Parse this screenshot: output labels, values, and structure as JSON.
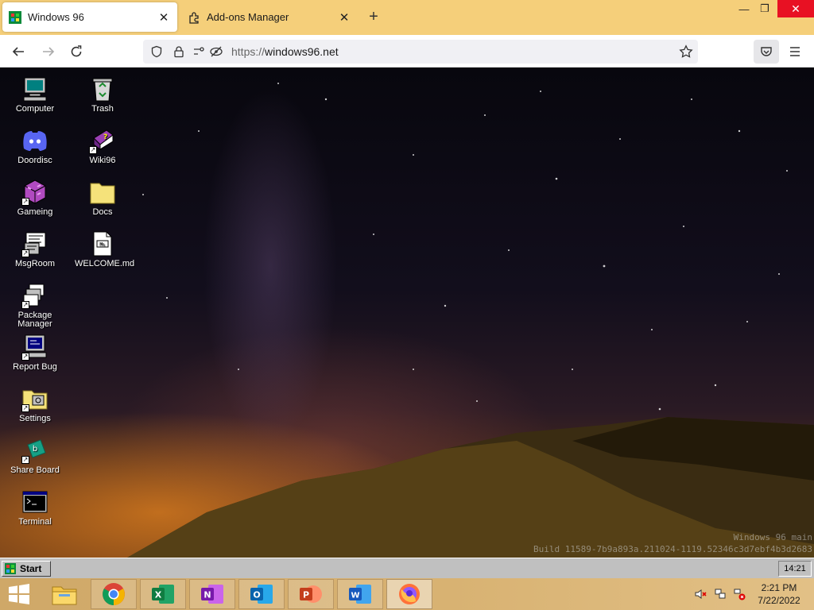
{
  "browser": {
    "tabs": [
      {
        "title": "Windows 96",
        "favicon": "windows96-favicon",
        "active": true
      },
      {
        "title": "Add-ons Manager",
        "favicon": "puzzle-piece-icon",
        "active": false
      }
    ],
    "new_tab_icon": "+",
    "url_scheme": "https://",
    "url_host": "windows96.net",
    "window_controls": {
      "minimize": "—",
      "restore": "❐",
      "close": "✕"
    }
  },
  "desktop": {
    "icons": [
      {
        "label": "Computer",
        "icon": "computer-icon"
      },
      {
        "label": "Trash",
        "icon": "recycle-bin-icon"
      },
      {
        "label": "Doordisc",
        "icon": "discord-icon"
      },
      {
        "label": "Wiki96",
        "icon": "help-book-icon"
      },
      {
        "label": "Gameing",
        "icon": "game-cube-icon"
      },
      {
        "label": "Docs",
        "icon": "folder-icon"
      },
      {
        "label": "MsgRoom",
        "icon": "chat-icon"
      },
      {
        "label": "WELCOME.md",
        "icon": "markdown-file-icon"
      },
      {
        "label": "Package Manager",
        "icon": "package-icon"
      },
      {
        "label": "Report Bug",
        "icon": "bug-report-icon"
      },
      {
        "label": "Settings",
        "icon": "settings-folder-icon"
      },
      {
        "label": "Share Board",
        "icon": "share-board-icon"
      },
      {
        "label": "Terminal",
        "icon": "terminal-icon"
      }
    ],
    "watermark_line1": "Windows 96 main",
    "watermark_line2": "Build 11589-7b9a893a.211024-1119.52346c3d7ebf4b3d2683"
  },
  "win96_taskbar": {
    "start_label": "Start",
    "clock": "14:21"
  },
  "windows_taskbar": {
    "apps": [
      "chrome-icon",
      "excel-icon",
      "onenote-icon",
      "outlook-icon",
      "powerpoint-icon",
      "word-icon",
      "firefox-icon"
    ],
    "time": "2:21 PM",
    "date": "7/22/2022",
    "colors": {
      "accent": "#d8b272",
      "tab_strip": "#f5cf7a"
    }
  }
}
